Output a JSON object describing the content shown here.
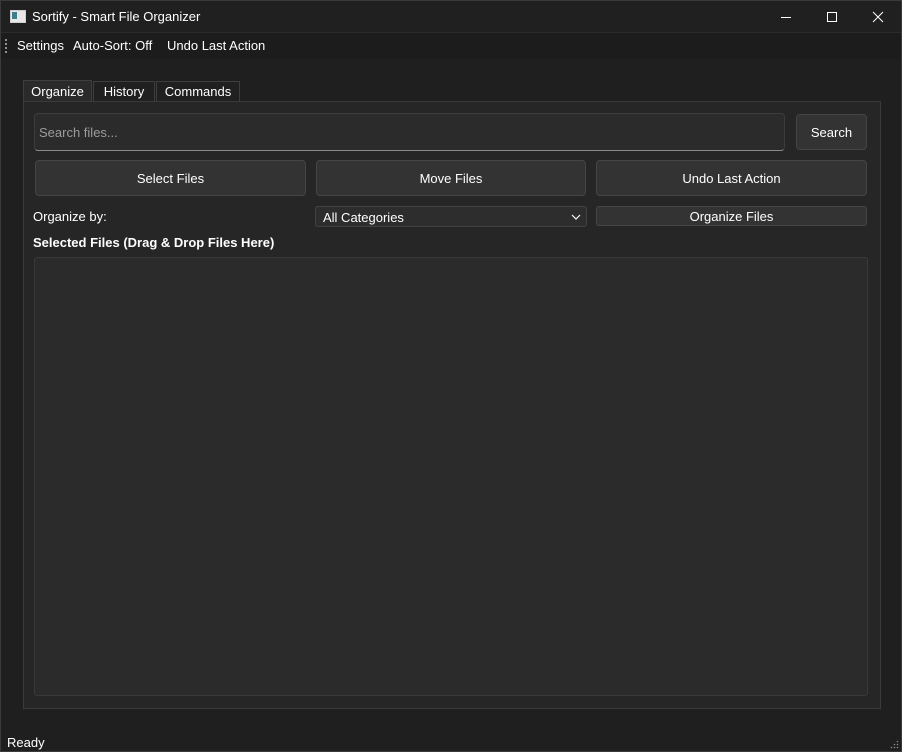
{
  "window": {
    "title": "Sortify - Smart File Organizer",
    "icon": "app-window-icon",
    "controls": [
      "minimize-icon",
      "maximize-icon",
      "close-icon"
    ]
  },
  "menu": {
    "settings": "Settings",
    "auto_sort": "Auto-Sort: Off",
    "undo": "Undo Last Action"
  },
  "tabs": [
    {
      "label": "Organize",
      "active": true
    },
    {
      "label": "History",
      "active": false
    },
    {
      "label": "Commands",
      "active": false
    }
  ],
  "organize": {
    "search": {
      "placeholder": "Search files...",
      "value": ""
    },
    "search_button": "Search",
    "select_files_button": "Select Files",
    "move_files_button": "Move Files",
    "undo_button": "Undo Last Action",
    "organize_by_label": "Organize by:",
    "category_select": {
      "value": "All Categories"
    },
    "organize_files_button": "Organize Files",
    "selected_files_label": "Selected Files (Drag & Drop Files Here)",
    "files": []
  },
  "status": {
    "text": "Ready"
  },
  "colors": {
    "background": "#1f1f1f",
    "panel": "#262626",
    "button": "#333333",
    "text": "#ffffff"
  }
}
